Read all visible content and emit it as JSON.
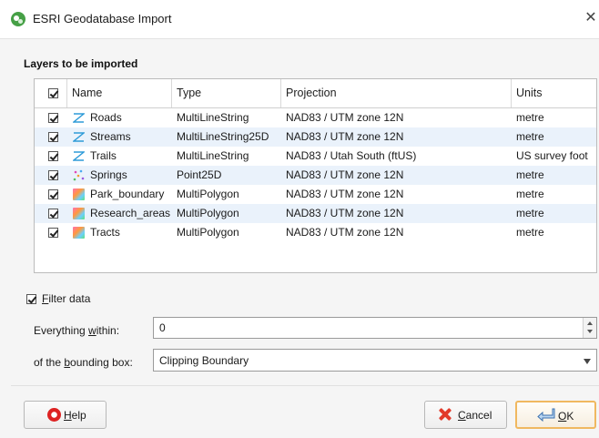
{
  "window": {
    "title": "ESRI Geodatabase Import",
    "close_glyph": "✕"
  },
  "layers_section": {
    "title": "Layers to be imported",
    "columns": {
      "name": "Name",
      "type": "Type",
      "projection": "Projection",
      "units": "Units"
    },
    "all_checked": true,
    "rows": [
      {
        "checked": true,
        "icon": "line-layer-icon",
        "name": "Roads",
        "type": "MultiLineString",
        "projection": "NAD83 / UTM zone 12N",
        "units": "metre"
      },
      {
        "checked": true,
        "icon": "line-layer-icon",
        "name": "Streams",
        "type": "MultiLineString25D",
        "projection": "NAD83 / UTM zone 12N",
        "units": "metre"
      },
      {
        "checked": true,
        "icon": "line-layer-icon",
        "name": "Trails",
        "type": "MultiLineString",
        "projection": "NAD83 / Utah South (ftUS)",
        "units": "US survey foot"
      },
      {
        "checked": true,
        "icon": "point-layer-icon",
        "name": "Springs",
        "type": "Point25D",
        "projection": "NAD83 / UTM zone 12N",
        "units": "metre"
      },
      {
        "checked": true,
        "icon": "polygon-layer-icon",
        "name": "Park_boundary",
        "type": "MultiPolygon",
        "projection": "NAD83 / UTM zone 12N",
        "units": "metre"
      },
      {
        "checked": true,
        "icon": "polygon-layer-icon",
        "name": "Research_areas",
        "type": "MultiPolygon",
        "projection": "NAD83 / UTM zone 12N",
        "units": "metre"
      },
      {
        "checked": true,
        "icon": "polygon-layer-icon",
        "name": "Tracts",
        "type": "MultiPolygon",
        "projection": "NAD83 / UTM zone 12N",
        "units": "metre"
      }
    ]
  },
  "filter": {
    "checked": true,
    "label_mnemonic": "F",
    "label_rest": "ilter data",
    "within_label_pre": "Everything ",
    "within_label_mnemonic": "w",
    "within_label_post": "ithin:",
    "within_value": "0",
    "bbox_label_pre": "of the ",
    "bbox_label_mnemonic": "b",
    "bbox_label_post": "ounding box:",
    "bbox_value": "Clipping Boundary"
  },
  "buttons": {
    "help_mnemonic": "H",
    "help_rest": "elp",
    "cancel_mnemonic": "C",
    "cancel_rest": "ancel",
    "ok_mnemonic": "O",
    "ok_rest": "K"
  },
  "colors": {
    "row_alt": "#eaf2fb",
    "ok_border": "#f0b860",
    "cancel_icon": "#e23a2a",
    "help_icon": "#dd2222"
  }
}
